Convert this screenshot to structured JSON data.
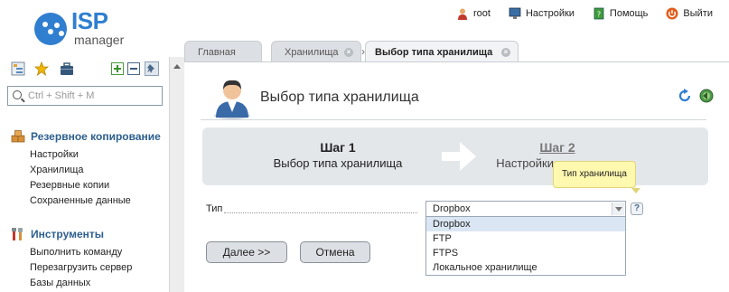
{
  "header": {
    "logo_big": "ISP",
    "logo_small": "manager",
    "user": "root",
    "settings": "Настройки",
    "help": "Помощь",
    "logout": "Выйти"
  },
  "sidebar": {
    "search_placeholder": "Ctrl + Shift + M",
    "sections": [
      {
        "title": "Резервное копирование",
        "items": [
          "Настройки",
          "Хранилища",
          "Резервные копии",
          "Сохраненные данные"
        ]
      },
      {
        "title": "Инструменты",
        "items": [
          "Выполнить команду",
          "Перезагрузить сервер",
          "Базы данных"
        ]
      }
    ]
  },
  "tabs": [
    {
      "label": "Главная"
    },
    {
      "label": "Хранилища"
    },
    {
      "label": "Выбор типа хранилища"
    }
  ],
  "page": {
    "title": "Выбор типа хранилища",
    "step1_title": "Шаг 1",
    "step1_sub": "Выбор типа хранилища",
    "step2_title": "Шаг 2",
    "step2_sub": "Настройки хранилища",
    "tooltip": "Тип хранилища",
    "field_label": "Тип",
    "select_value": "Dropbox",
    "help_mark": "?",
    "options": [
      "Dropbox",
      "FTP",
      "FTPS",
      "Локальное хранилище"
    ],
    "next_button": "Далее >>",
    "cancel_button": "Отмена"
  },
  "colors": {
    "accent": "#2f7ed0",
    "section_title": "#2d5f8f",
    "tooltip_bg": "#fff9b0",
    "selected_option": "#dbe6f4"
  }
}
